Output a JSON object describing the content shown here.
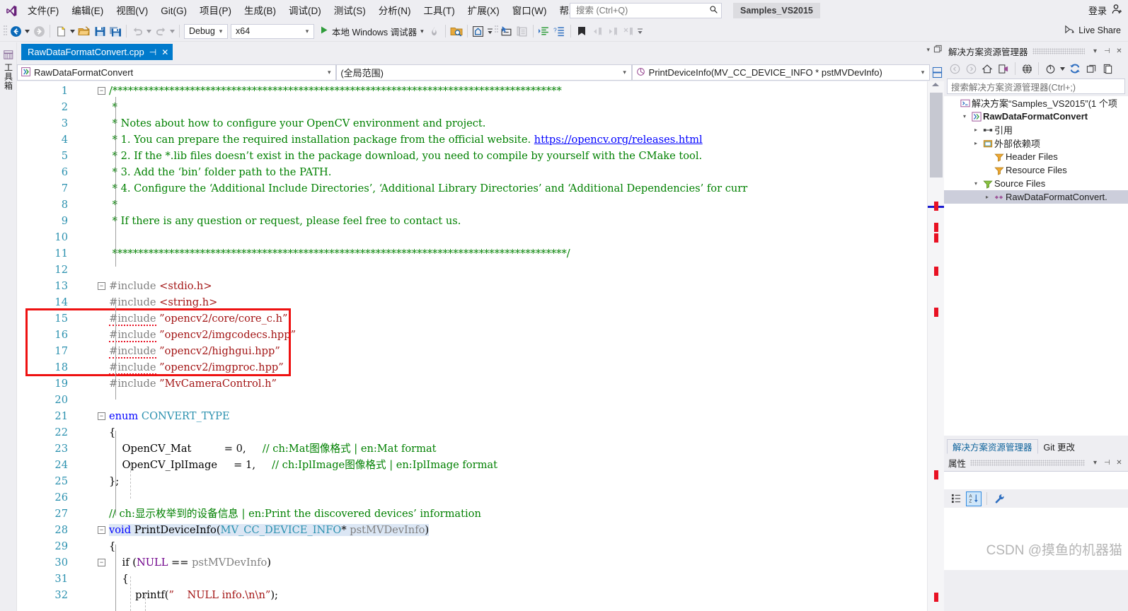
{
  "app": {
    "logo_icon": "visual-studio-logo",
    "solution_name": "Samples_VS2015",
    "signin_label": "登录",
    "signin_icon": "account-person-icon",
    "liveshare_label": "Live Share",
    "liveshare_icon": "live-share-icon"
  },
  "menu": {
    "items": [
      {
        "label": "文件(F)"
      },
      {
        "label": "编辑(E)"
      },
      {
        "label": "视图(V)"
      },
      {
        "label": "Git(G)"
      },
      {
        "label": "项目(P)"
      },
      {
        "label": "生成(B)"
      },
      {
        "label": "调试(D)"
      },
      {
        "label": "测试(S)"
      },
      {
        "label": "分析(N)"
      },
      {
        "label": "工具(T)"
      },
      {
        "label": "扩展(X)"
      },
      {
        "label": "窗口(W)"
      },
      {
        "label": "帮助(H)"
      }
    ]
  },
  "quick_search": {
    "placeholder": "搜索 (Ctrl+Q)",
    "value": "",
    "icon": "search-icon"
  },
  "toolbar": {
    "nav_back_icon": "navigate-back-icon",
    "nav_forward_icon": "navigate-forward-icon",
    "new_item_icon": "new-item-icon",
    "open_file_icon": "open-folder-icon",
    "save_icon": "save-icon",
    "save_all_icon": "save-all-icon",
    "undo_icon": "undo-icon",
    "redo_icon": "redo-icon",
    "config_value": "Debug",
    "platform_value": "x64",
    "run_label": "本地 Windows 调试器",
    "run_icon": "play-icon",
    "hotreload_icon": "hot-reload-icon",
    "find_in_files_icon": "find-in-files-icon",
    "home_frame_icon": "window-layout-icon",
    "select_element_icon": "select-element-icon",
    "copy_layout_icon": "copy-layout-icon",
    "indent_icon": "format-document-icon",
    "comment_icon": "comment-selection-icon",
    "bookmark_icon": "bookmark-icon",
    "prev_bookmark_icon": "previous-bookmark-icon",
    "next_bookmark_icon": "next-bookmark-icon",
    "clear_bookmark_icon": "clear-bookmarks-icon",
    "overflow_icon": "toolbar-overflow-icon"
  },
  "left_strip": {
    "toolbox_label": "工具箱",
    "toolbox_icon": "toolbox-icon"
  },
  "document_tab": {
    "title": "RawDataFormatConvert.cpp",
    "pin_icon": "pin-icon",
    "close_icon": "close-icon",
    "dropdown_icon": "chevron-down-icon",
    "restore_icon": "restore-window-icon"
  },
  "navbar": {
    "project_value": "RawDataFormatConvert",
    "project_icon": "cpp-project-icon",
    "scope_value": "(全局范围)",
    "member_value": "PrintDeviceInfo(MV_CC_DEVICE_INFO * pstMVDevInfo)",
    "member_icon": "method-icon",
    "split_icon": "split-window-icon"
  },
  "editor": {
    "first_line": 1,
    "lines": [
      {
        "n": 1,
        "fold": "minus",
        "tokens": [
          {
            "t": "/***************************************************************************************",
            "c": "c-com"
          }
        ]
      },
      {
        "n": 2,
        "tokens": [
          {
            "t": " *",
            "c": "c-com"
          }
        ]
      },
      {
        "n": 3,
        "tokens": [
          {
            "t": " * Notes about how to configure your OpenCV environment and project.",
            "c": "c-com"
          }
        ]
      },
      {
        "n": 4,
        "tokens": [
          {
            "t": " * 1. You can prepare the required installation package from the official website. ",
            "c": "c-com"
          },
          {
            "t": "https://opencv.org/releases.html",
            "c": "c-link"
          }
        ]
      },
      {
        "n": 5,
        "tokens": [
          {
            "t": " * 2. If the *.lib files doesn’t exist in the package download, you need to compile by yourself with the CMake tool.",
            "c": "c-com"
          }
        ]
      },
      {
        "n": 6,
        "tokens": [
          {
            "t": " * 3. Add the ‘bin’ folder path to the PATH.",
            "c": "c-com"
          }
        ]
      },
      {
        "n": 7,
        "tokens": [
          {
            "t": " * 4. Configure the ‘Additional Include Directories’, ‘Additional Library Directories’ and ‘Additional Dependencies’ for curr",
            "c": "c-com"
          }
        ]
      },
      {
        "n": 8,
        "tokens": [
          {
            "t": " *",
            "c": "c-com"
          }
        ]
      },
      {
        "n": 9,
        "tokens": [
          {
            "t": " * If there is any question or request, please feel free to contact us.",
            "c": "c-com"
          }
        ]
      },
      {
        "n": 10,
        "tokens": []
      },
      {
        "n": 11,
        "tokens": [
          {
            "t": " ****************************************************************************************/",
            "c": "c-com"
          }
        ]
      },
      {
        "n": 12,
        "tokens": []
      },
      {
        "n": 13,
        "fold": "minus",
        "tokens": [
          {
            "t": "#include ",
            "c": "c-pp"
          },
          {
            "t": "<stdio.h>",
            "c": "c-str"
          }
        ]
      },
      {
        "n": 14,
        "tokens": [
          {
            "t": "#include ",
            "c": "c-pp"
          },
          {
            "t": "<string.h>",
            "c": "c-str"
          }
        ]
      },
      {
        "n": 15,
        "tokens": [
          {
            "t": "#include",
            "c": "c-pp",
            "squiggle": true
          },
          {
            "t": " ",
            "c": "c-pp"
          },
          {
            "t": "”opencv2/core/core_c.h”",
            "c": "c-str"
          }
        ]
      },
      {
        "n": 16,
        "tokens": [
          {
            "t": "#include",
            "c": "c-pp",
            "squiggle": true
          },
          {
            "t": " ",
            "c": "c-pp"
          },
          {
            "t": "”opencv2/imgcodecs.hpp”",
            "c": "c-str"
          }
        ]
      },
      {
        "n": 17,
        "tokens": [
          {
            "t": "#include",
            "c": "c-pp",
            "squiggle": true
          },
          {
            "t": " ",
            "c": "c-pp"
          },
          {
            "t": "”opencv2/highgui.hpp”",
            "c": "c-str"
          }
        ]
      },
      {
        "n": 18,
        "tokens": [
          {
            "t": "#include",
            "c": "c-pp",
            "squiggle": true
          },
          {
            "t": " ",
            "c": "c-pp"
          },
          {
            "t": "”opencv2/imgproc.hpp”",
            "c": "c-str"
          }
        ]
      },
      {
        "n": 19,
        "tokens": [
          {
            "t": "#include ",
            "c": "c-pp"
          },
          {
            "t": "”MvCameraControl.h”",
            "c": "c-str"
          }
        ]
      },
      {
        "n": 20,
        "tokens": []
      },
      {
        "n": 21,
        "fold": "minus",
        "tokens": [
          {
            "t": "enum ",
            "c": "c-kw"
          },
          {
            "t": "CONVERT_TYPE",
            "c": "c-type"
          }
        ]
      },
      {
        "n": 22,
        "tokens": [
          {
            "t": "{",
            "c": "c-txt"
          }
        ]
      },
      {
        "n": 23,
        "tokens": [
          {
            "t": "    OpenCV_Mat          = ",
            "c": "c-txt"
          },
          {
            "t": "0",
            "c": "c-num"
          },
          {
            "t": ",     ",
            "c": "c-txt"
          },
          {
            "t": "// ch:Mat图像格式 | en:Mat format",
            "c": "c-com"
          }
        ]
      },
      {
        "n": 24,
        "tokens": [
          {
            "t": "    OpenCV_IplImage     = ",
            "c": "c-txt"
          },
          {
            "t": "1",
            "c": "c-num"
          },
          {
            "t": ",     ",
            "c": "c-txt"
          },
          {
            "t": "// ch:IplImage图像格式 | en:IplImage format",
            "c": "c-com"
          }
        ]
      },
      {
        "n": 25,
        "tokens": [
          {
            "t": "};",
            "c": "c-txt"
          }
        ]
      },
      {
        "n": 26,
        "tokens": []
      },
      {
        "n": 27,
        "tokens": [
          {
            "t": "// ch:显示枚举到的设备信息 | en:Print the discovered devices’ information",
            "c": "c-com"
          }
        ]
      },
      {
        "n": 28,
        "fold": "minus",
        "highlight": true,
        "tokens": [
          {
            "t": "void ",
            "c": "c-kw"
          },
          {
            "t": "PrintDeviceInfo",
            "c": "c-txt"
          },
          {
            "t": "(",
            "c": "c-txt"
          },
          {
            "t": "MV_CC_DEVICE_INFO",
            "c": "c-type"
          },
          {
            "t": "* ",
            "c": "c-txt"
          },
          {
            "t": "pstMVDevInfo",
            "c": "c-id"
          },
          {
            "t": ")",
            "c": "c-txt"
          }
        ]
      },
      {
        "n": 29,
        "tokens": [
          {
            "t": "{",
            "c": "c-txt"
          }
        ]
      },
      {
        "n": 30,
        "fold": "minus",
        "tokens": [
          {
            "t": "    if (",
            "c": "c-txt"
          },
          {
            "t": "NULL",
            "c": "c-macro"
          },
          {
            "t": " == ",
            "c": "c-txt"
          },
          {
            "t": "pstMVDevInfo",
            "c": "c-id"
          },
          {
            "t": ")",
            "c": "c-txt"
          }
        ]
      },
      {
        "n": 31,
        "tokens": [
          {
            "t": "    {",
            "c": "c-txt"
          }
        ]
      },
      {
        "n": 32,
        "tokens": [
          {
            "t": "        printf(",
            "c": "c-txt"
          },
          {
            "t": "”    NULL info.\\n\\n”",
            "c": "c-str"
          },
          {
            "t": ");",
            "c": "c-txt"
          }
        ]
      }
    ],
    "annotation": {
      "name": "red-highlight-rectangle",
      "color": "#ee1111",
      "covers_lines": [
        15,
        16,
        17,
        18
      ]
    }
  },
  "solution_explorer": {
    "title": "解决方案资源管理器",
    "search_placeholder": "搜索解决方案资源管理器(Ctrl+;)",
    "toolbar_icons": [
      "back-icon",
      "forward-icon",
      "home-icon",
      "sync-with-active-document-icon",
      "show-all-files-icon",
      "pending-changes-filter-icon",
      "refresh-icon",
      "collapse-all-icon",
      "properties-icon"
    ],
    "tree": [
      {
        "indent": 0,
        "expander": "none",
        "icon": "solution-icon",
        "label": "解决方案“Samples_VS2015”(1 个项",
        "bold": false,
        "selected": false
      },
      {
        "indent": 1,
        "expander": "expanded",
        "icon": "cpp-project-icon",
        "label": "RawDataFormatConvert",
        "bold": true,
        "selected": false
      },
      {
        "indent": 2,
        "expander": "collapsed",
        "icon": "references-icon",
        "label": "引用",
        "bold": false,
        "selected": false
      },
      {
        "indent": 2,
        "expander": "collapsed",
        "icon": "external-deps-icon",
        "label": "外部依赖项",
        "bold": false,
        "selected": false
      },
      {
        "indent": 3,
        "expander": "none",
        "icon": "filter-folder-icon",
        "label": "Header Files",
        "bold": false,
        "selected": false
      },
      {
        "indent": 3,
        "expander": "none",
        "icon": "filter-folder-icon",
        "label": "Resource Files",
        "bold": false,
        "selected": false
      },
      {
        "indent": 2,
        "expander": "expanded",
        "icon": "filter-folder-open-icon",
        "label": "Source Files",
        "bold": false,
        "selected": false
      },
      {
        "indent": 3,
        "expander": "collapsed",
        "icon": "cpp-file-icon",
        "label": "RawDataFormatConvert.",
        "bold": false,
        "selected": true
      }
    ]
  },
  "bottom_tabs": [
    {
      "label": "解决方案资源管理器",
      "active": true
    },
    {
      "label": "Git 更改",
      "active": false
    }
  ],
  "properties": {
    "title": "属性",
    "categorized_icon": "categorized-view-icon",
    "alphabetical_icon": "alphabetical-sort-icon",
    "property_pages_icon": "property-pages-wrench-icon"
  },
  "watermark": "CSDN @摸鱼的机器猫"
}
